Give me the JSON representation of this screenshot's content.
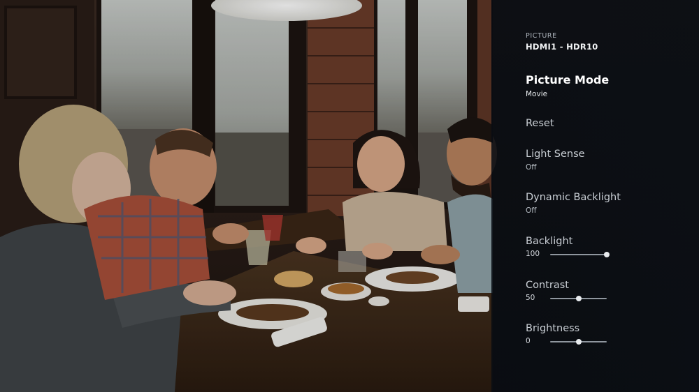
{
  "background": {
    "description_icon": "restaurant-photo"
  },
  "header": {
    "section": "PICTURE",
    "source": "HDMI1 - HDR10"
  },
  "menu": {
    "picture_mode": {
      "label": "Picture Mode",
      "value": "Movie"
    },
    "reset": {
      "label": "Reset"
    },
    "light_sense": {
      "label": "Light Sense",
      "value": "Off"
    },
    "dynamic_backlight": {
      "label": "Dynamic Backlight",
      "value": "Off"
    },
    "backlight": {
      "label": "Backlight",
      "value": "100",
      "level": 1.0
    },
    "contrast": {
      "label": "Contrast",
      "value": "50",
      "level": 0.5
    },
    "brightness": {
      "label": "Brightness",
      "value": "0",
      "level": 0.5
    }
  },
  "colors": {
    "panel": "#0b0f15",
    "text": "#ffffff",
    "slider_track": "#8f969e"
  }
}
